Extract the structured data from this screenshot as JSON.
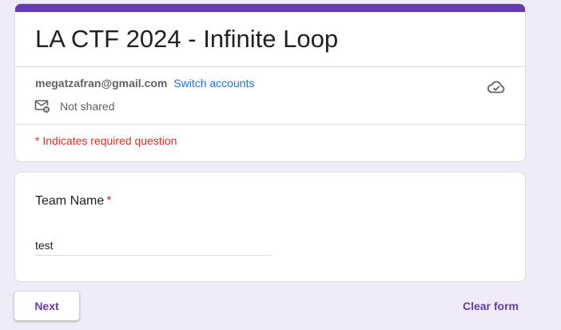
{
  "form": {
    "title": "LA CTF 2024 - Infinite Loop",
    "account": {
      "email": "megatzafran@gmail.com",
      "switch_label": "Switch accounts",
      "share_status": "Not shared"
    },
    "required_note": "* Indicates required question"
  },
  "question": {
    "title": "Team Name",
    "required_mark": "*",
    "answer_value": "test"
  },
  "actions": {
    "next_label": "Next",
    "clear_label": "Clear form"
  },
  "icons": {
    "cloud": "cloud-check-icon",
    "share": "mail-off-icon"
  },
  "colors": {
    "accent": "#673ab7",
    "background": "#f0ebf8",
    "link": "#1a73e8",
    "required": "#d93025"
  }
}
